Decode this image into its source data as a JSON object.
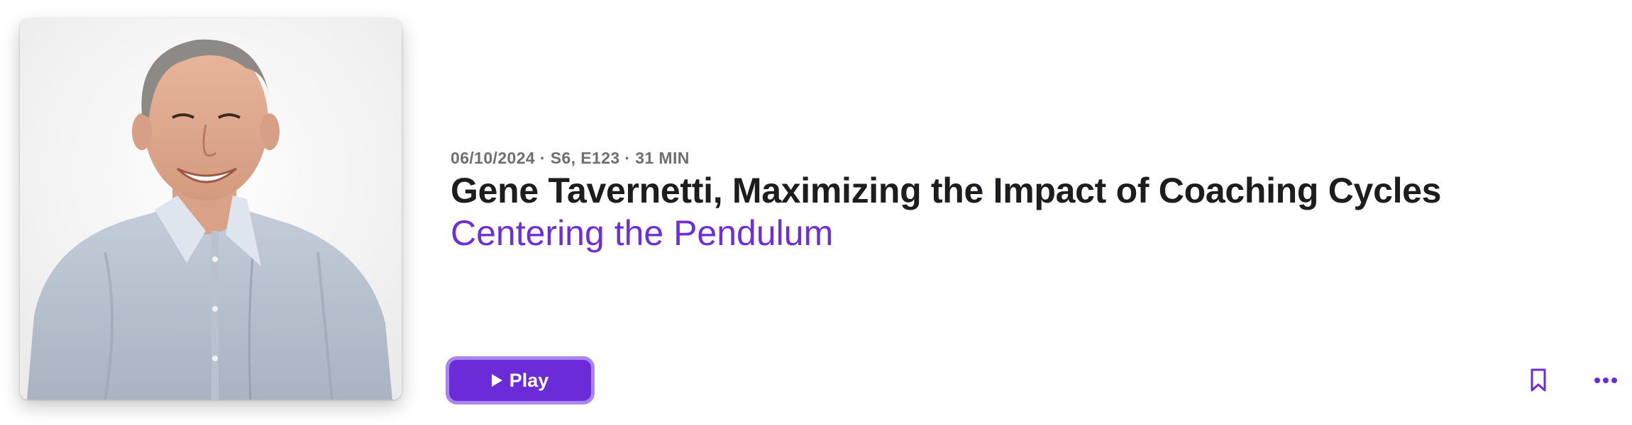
{
  "episode": {
    "meta": "06/10/2024 · S6, E123 · 31 MIN",
    "title": "Gene Tavernetti, Maximizing the Impact of Coaching Cycles",
    "show": "Centering the Pendulum"
  },
  "actions": {
    "play_label": "Play",
    "play_icon": "play-icon",
    "bookmark_icon": "bookmark-icon",
    "more_icon": "ellipsis-icon"
  },
  "colors": {
    "accent": "#6c2bd9",
    "accent_border": "#a886ee",
    "title": "#1d1d1f",
    "meta": "#6e6e73"
  }
}
